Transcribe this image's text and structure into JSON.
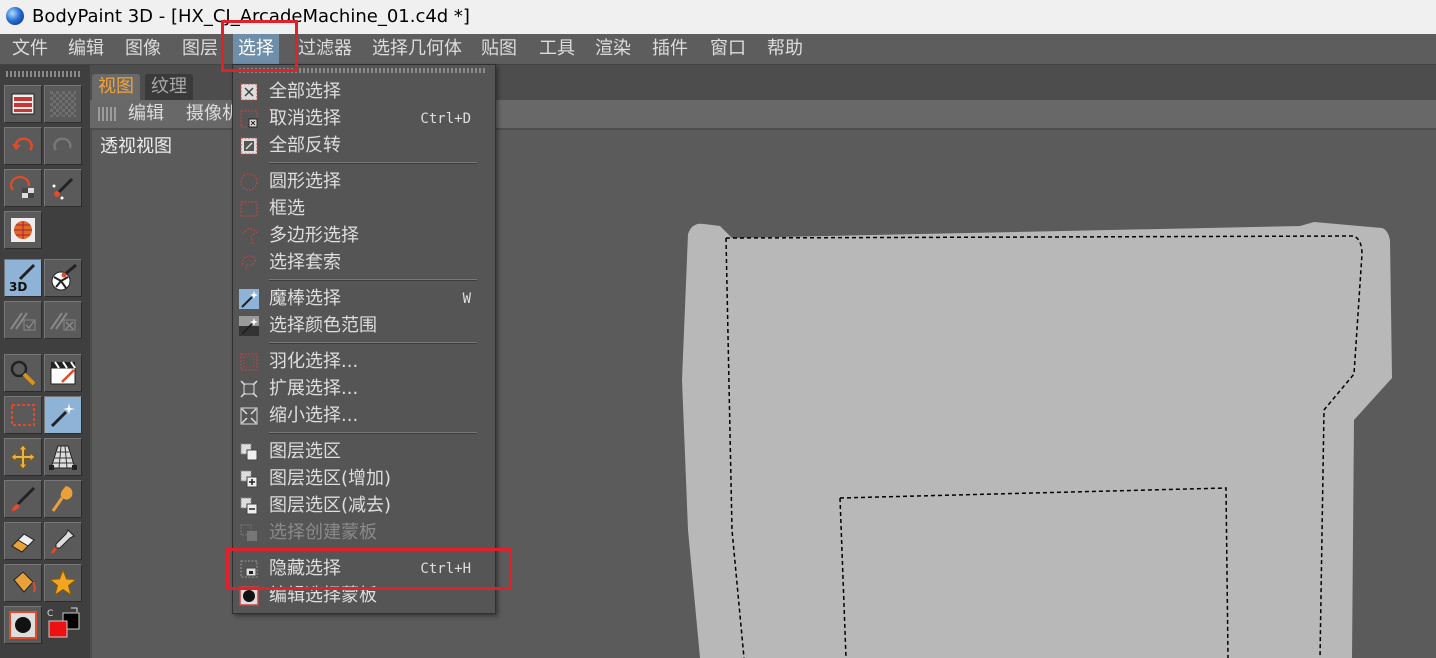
{
  "window": {
    "title": "BodyPaint 3D - [HX_CJ_ArcadeMachine_01.c4d *]"
  },
  "menubar": [
    "文件",
    "编辑",
    "图像",
    "图层",
    "选择",
    "过滤器",
    "选择几何体",
    "贴图",
    "工具",
    "渲染",
    "插件",
    "窗口",
    "帮助"
  ],
  "active_menu": "选择",
  "view": {
    "tabs": [
      "视图",
      "纹理"
    ],
    "toolbar": [
      "编辑",
      "摄像机"
    ],
    "viewport_label": "透视视图"
  },
  "select_menu": {
    "items": [
      {
        "label": "全部选择",
        "icon": "select-all-icon"
      },
      {
        "label": "取消选择",
        "shortcut": "Ctrl+D",
        "icon": "deselect-icon"
      },
      {
        "label": "全部反转",
        "icon": "invert-selection-icon"
      },
      {
        "label": "圆形选择",
        "icon": "circle-select-icon"
      },
      {
        "label": "框选",
        "icon": "rectangle-select-icon"
      },
      {
        "label": "多边形选择",
        "icon": "polygon-select-icon"
      },
      {
        "label": "选择套索",
        "icon": "lasso-icon"
      },
      {
        "label": "魔棒选择",
        "shortcut": "W",
        "icon": "magic-wand-icon"
      },
      {
        "label": "选择颜色范围",
        "icon": "color-range-icon"
      },
      {
        "label": "羽化选择...",
        "icon": "feather-selection-icon"
      },
      {
        "label": "扩展选择...",
        "icon": "expand-selection-icon"
      },
      {
        "label": "缩小选择...",
        "icon": "shrink-selection-icon"
      },
      {
        "label": "图层选区",
        "icon": "layer-selection-icon"
      },
      {
        "label": "图层选区(增加)",
        "icon": "layer-selection-add-icon"
      },
      {
        "label": "图层选区(减去)",
        "icon": "layer-selection-subtract-icon"
      },
      {
        "label": "选择创建蒙板",
        "icon": "create-mask-icon",
        "disabled": true
      },
      {
        "label": "隐藏选择",
        "shortcut": "Ctrl+H",
        "icon": "hide-selection-icon"
      },
      {
        "label": "编辑选择蒙板",
        "icon": "edit-mask-icon"
      }
    ]
  },
  "colors": {
    "highlight_box": "#e0202a",
    "active_menu_bg": "#6f8ea9",
    "active_tab_text": "#f3a33a",
    "mesh_fill": "#b8b8b8",
    "foreground_color": "#ee1111",
    "background_color": "#000000"
  },
  "tools": [
    "layer-manager-icon",
    "checker-icon",
    "undo-icon",
    "redo-icon",
    "paint-setup-icon",
    "brush-sparkle-icon",
    "texture-sphere-icon",
    "3d-paint-icon",
    "paint-sphere-icon",
    "projection-check-icon",
    "projection-x-icon",
    "zoom-icon",
    "clapper-icon",
    "rect-select-tool-icon",
    "magic-wand-tool-icon",
    "move-tool-icon",
    "transform-tool-icon",
    "brush-tool-icon",
    "smudge-tool-icon",
    "eraser-tool-icon",
    "eyedropper-tool-icon",
    "fill-bucket-icon",
    "star-shape-icon",
    "quick-mask-icon",
    "color-swatches-icon"
  ]
}
